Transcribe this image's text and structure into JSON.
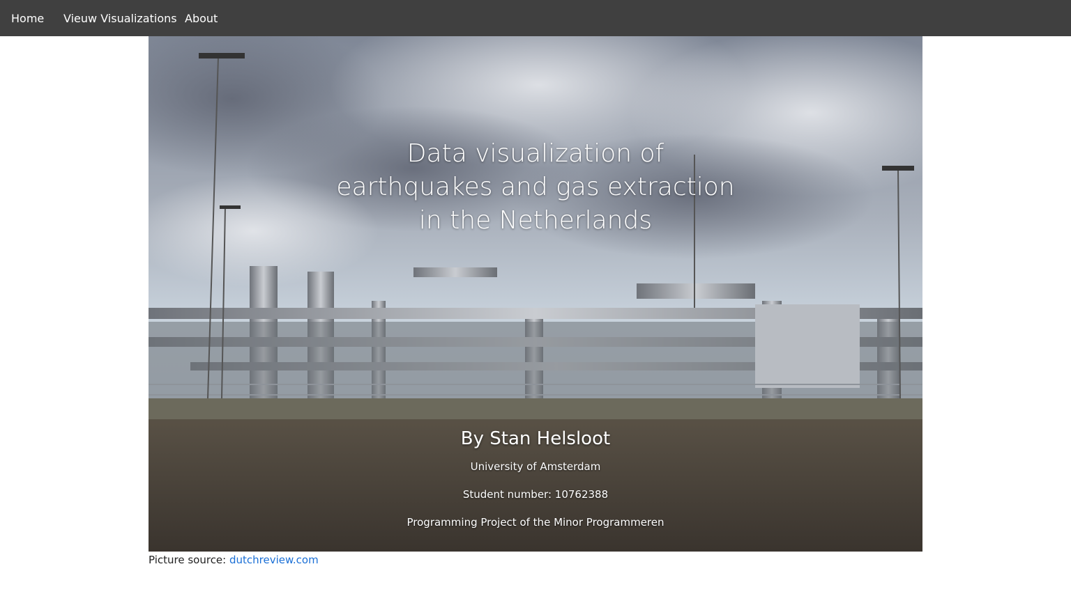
{
  "nav": {
    "home": "Home",
    "visualizations": "Vieuw Visualizations",
    "about": "About"
  },
  "hero": {
    "title_line1": "Data visualization of",
    "title_line2": "earthquakes and gas extraction",
    "title_line3": "in the Netherlands",
    "author": "By Stan Helsloot",
    "university": "University of Amsterdam",
    "student_number": "Student number: 10762388",
    "project": "Programming Project of the Minor Programmeren"
  },
  "footer": {
    "source_label": "Picture source:",
    "source_link": "dutchreview.com"
  },
  "colors": {
    "navbar": "#404040",
    "link": "#1a6fd6"
  }
}
